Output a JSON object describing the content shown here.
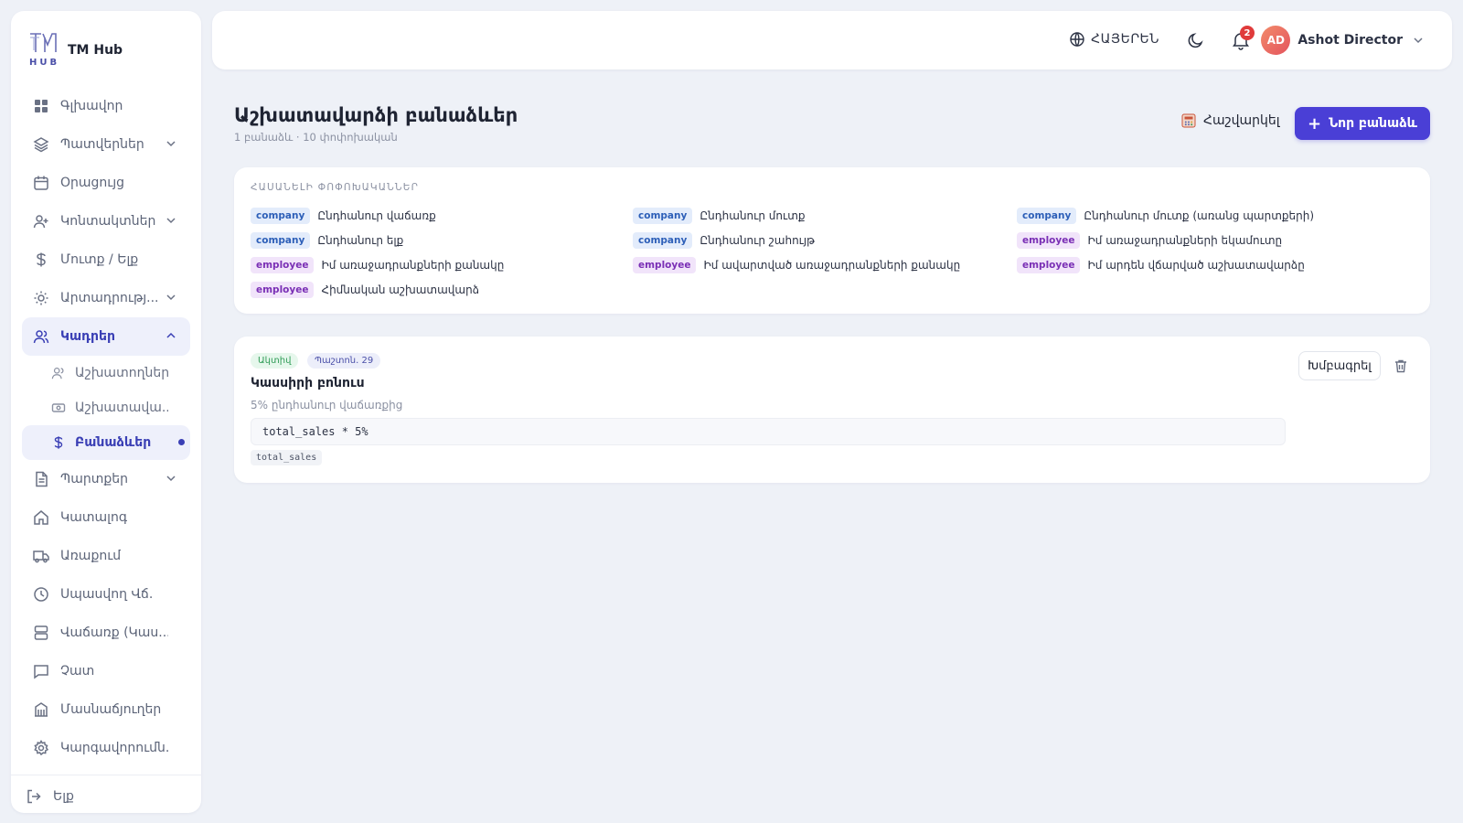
{
  "brand": {
    "logo_text": "HUB",
    "title": "TM Hub"
  },
  "sidebar": {
    "items": [
      {
        "label": "Գլխավոր",
        "icon": "grid-icon"
      },
      {
        "label": "Պատվերներ",
        "icon": "layers-icon",
        "chevron": true
      },
      {
        "label": "Օրացույց",
        "icon": "calendar-icon"
      },
      {
        "label": "Կոնտակտներ",
        "icon": "user-plus-icon",
        "chevron": true
      },
      {
        "label": "Մուտք / Ելք",
        "icon": "dollar-icon"
      },
      {
        "label": "Արտադրությ...",
        "icon": "sun-icon",
        "chevron": true
      },
      {
        "label": "Կադրեր",
        "icon": "users-icon",
        "expanded": true
      },
      {
        "label": "Պարտքեր",
        "icon": "file-icon",
        "chevron": true
      },
      {
        "label": "Կատալոգ",
        "icon": "home-icon"
      },
      {
        "label": "Առաքում",
        "icon": "truck-icon"
      },
      {
        "label": "Սպասվող Վճ.",
        "icon": "clock-icon"
      },
      {
        "label": "Վաճառք (Կաս...",
        "icon": "server-icon"
      },
      {
        "label": "Չատ",
        "icon": "chat-icon"
      },
      {
        "label": "Մասնաճյուղեր",
        "icon": "building-icon"
      },
      {
        "label": "Կարգավորումն...",
        "icon": "gear-icon"
      }
    ],
    "subitems": [
      {
        "label": "Աշխատողներ",
        "icon": "users-icon"
      },
      {
        "label": "Աշխատավա...",
        "icon": "banknote-icon"
      },
      {
        "label": "Բանաձևեր",
        "icon": "dollar-icon"
      }
    ],
    "logout": "Ելք"
  },
  "topbar": {
    "language": "ՀԱՅԵՐԵՆ",
    "notifications_count": "2",
    "user_initials": "AD",
    "user_name": "Ashot Director"
  },
  "header": {
    "title": "Աշխատավարձի բանաձևեր",
    "subtitle": "1 բանաձև · 10 փոփոխական",
    "calc_label": "Հաշվարկել",
    "new_label": "Նոր բանաձև"
  },
  "variables": {
    "heading": "ՀԱՍԱՆԵԼԻ ՓՈՓՈԽԱԿԱՆՆԵՐ",
    "items": [
      {
        "scope": "company",
        "label": "Ընդհանուր վաճառք"
      },
      {
        "scope": "company",
        "label": "Ընդհանուր մուտք"
      },
      {
        "scope": "company",
        "label": "Ընդհանուր մուտք (առանց պարտքերի)"
      },
      {
        "scope": "company",
        "label": "Ընդհանուր ելք"
      },
      {
        "scope": "company",
        "label": "Ընդհանուր շահույթ"
      },
      {
        "scope": "employee",
        "label": "Իմ առաջադրանքների եկամուտը"
      },
      {
        "scope": "employee",
        "label": "Իմ առաջադրանքների քանակը"
      },
      {
        "scope": "employee",
        "label": "Իմ ավարտված առաջադրանքների քանակը"
      },
      {
        "scope": "employee",
        "label": "Իմ արդեն վճարված աշխատավարձը"
      },
      {
        "scope": "employee",
        "label": "Հիմնական աշխատավարձ"
      }
    ]
  },
  "formula": {
    "status": "Ակտիվ",
    "type": "Պաշտոն. 29",
    "title": "Կասսիրի բոնուս",
    "description": "5% ընդհանուր վաճառքից",
    "expression": "total_sales * 5%",
    "variable": "total_sales",
    "edit_label": "Խմբագրել"
  },
  "colors": {
    "accent": "#4a3fd6",
    "active_bg": "#eef0fb",
    "active_text": "#3a3fb5",
    "danger": "#e03b3b"
  }
}
